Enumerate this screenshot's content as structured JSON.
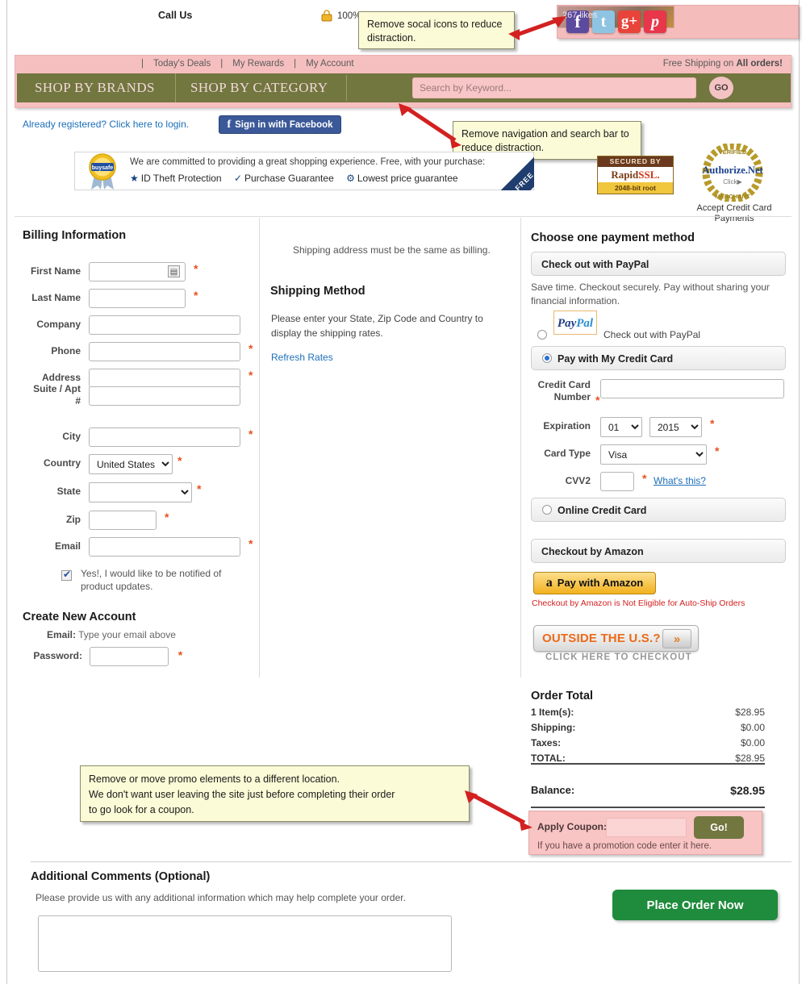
{
  "topbar": {
    "call_us": "Call Us",
    "ssl_percent": "100%",
    "lock_icon": "lock-icon",
    "social": {
      "facebook": "f",
      "twitter": "t",
      "googleplus": "g+",
      "pinterest": "p",
      "likes": "267 likes"
    }
  },
  "callouts": {
    "social": "Remove socal icons to reduce distraction.",
    "nav": "Remove navigation and search bar to reduce distraction.",
    "promo": "Remove or move promo elements to a different location.\nWe don't want user leaving the site just before completing their order\nto go look for a coupon."
  },
  "nav": {
    "links": [
      "Today's Deals",
      "My Rewards",
      "My Account"
    ],
    "free_shipping_prefix": "Free Shipping on ",
    "free_shipping_bold": "All orders!",
    "shop_by_brands": "SHOP BY BRANDS",
    "shop_by_category": "SHOP BY CATEGORY",
    "search_placeholder": "Search by Keyword...",
    "search_value": "",
    "go_label": "GO"
  },
  "login": {
    "link": "Already registered? Click here to login.",
    "facebook_button": "Sign in with Facebook"
  },
  "trust": {
    "buysafe_brand": "buysafe",
    "line1": "We are committed to providing a great shopping experience. Free, with your purchase:",
    "badges": [
      "ID Theft Protection",
      "Purchase Guarantee",
      "Lowest price guarantee"
    ],
    "free_ribbon": "FREE",
    "rapidssl": {
      "top": "SECURED BY",
      "rapid": "Rapid",
      "ssl": "SSL.",
      "bottom": "2048-bit root"
    },
    "authorize": {
      "verified": "VERIFIED",
      "merchant": "MERCHANT",
      "brand": "Authorize.Net",
      "click": "Click",
      "caption": "Accept Credit Card Payments"
    }
  },
  "billing": {
    "title": "Billing Information",
    "fields": [
      {
        "label": "First Name",
        "value": "",
        "required": true,
        "type": "text"
      },
      {
        "label": "Last Name",
        "value": "",
        "required": true,
        "type": "text"
      },
      {
        "label": "Company",
        "value": "",
        "required": false,
        "type": "text"
      },
      {
        "label": "Phone",
        "value": "",
        "required": true,
        "type": "text"
      },
      {
        "label": "Address",
        "value": "",
        "required": true,
        "type": "text"
      },
      {
        "label": "Suite / Apt #",
        "value": "",
        "required": false,
        "type": "text"
      },
      {
        "label": "City",
        "value": "",
        "required": true,
        "type": "text"
      },
      {
        "label": "Country",
        "value": "United States",
        "required": true,
        "type": "select"
      },
      {
        "label": "State",
        "value": "",
        "required": true,
        "type": "select"
      },
      {
        "label": "Zip",
        "value": "",
        "required": true,
        "type": "text"
      },
      {
        "label": "Email",
        "value": "",
        "required": true,
        "type": "text"
      }
    ],
    "newsletter_checked": true,
    "newsletter_label": "Yes!, I would like to be notified of product updates."
  },
  "create_account": {
    "title": "Create New Account",
    "email_label": "Email:",
    "email_hint": "Type your email above",
    "password_label": "Password:",
    "password_value": ""
  },
  "shipping": {
    "same_as_billing": "Shipping address must be the same as billing.",
    "method_title": "Shipping Method",
    "note": "Please enter your State, Zip Code and Country to display the shipping rates.",
    "refresh_rates": "Refresh Rates"
  },
  "payment": {
    "title": "Choose one payment method",
    "paypal_bar": "Check out with PayPal",
    "paypal_desc": "Save time. Checkout securely. Pay without sharing your financial information.",
    "paypal_logo": "PayPal",
    "paypal_radio_label": "Check out with PayPal",
    "paypal_selected": false,
    "creditcard_bar": "Pay with My Credit Card",
    "creditcard_selected": true,
    "cc_number_label": "Credit Card Number",
    "cc_number_value": "",
    "expiration_label": "Expiration",
    "expiration_month": "01",
    "expiration_year": "2015",
    "card_type_label": "Card Type",
    "card_type_value": "Visa",
    "cvv_label": "CVV2",
    "cvv_value": "",
    "cvv_help": "What's this?",
    "online_cc_bar": "Online Credit Card",
    "online_cc_selected": false,
    "amazon_bar": "Checkout by Amazon",
    "amazon_button": "Pay with Amazon",
    "amazon_note": "Checkout by Amazon is Not Eligible for Auto-Ship Orders",
    "outside_us": "OUTSIDE THE U.S.?",
    "outside_us_sub": "CLICK HERE TO CHECKOUT"
  },
  "order_total": {
    "title": "Order Total",
    "rows": [
      {
        "label": "1 Item(s):",
        "value": "$28.95"
      },
      {
        "label": "Shipping:",
        "value": "$0.00"
      },
      {
        "label": "Taxes:",
        "value": "$0.00"
      },
      {
        "label": "TOTAL:",
        "value": "$28.95"
      }
    ],
    "balance_label": "Balance:",
    "balance_value": "$28.95"
  },
  "coupon": {
    "label": "Apply Coupon:",
    "value": "",
    "go_label": "Go!",
    "hint": "If you have a promotion code enter it here."
  },
  "comments": {
    "title": "Additional Comments (Optional)",
    "note": "Please provide us with any additional information which may help complete your order.",
    "value": ""
  },
  "place_order": {
    "label": "Place Order Now"
  },
  "colors": {
    "accent_green": "#72763f",
    "pink": "#f6bfbf",
    "required_orange": "#e8511f",
    "link_blue": "#1c6fb8",
    "place_order_green": "#1f8b3c"
  }
}
